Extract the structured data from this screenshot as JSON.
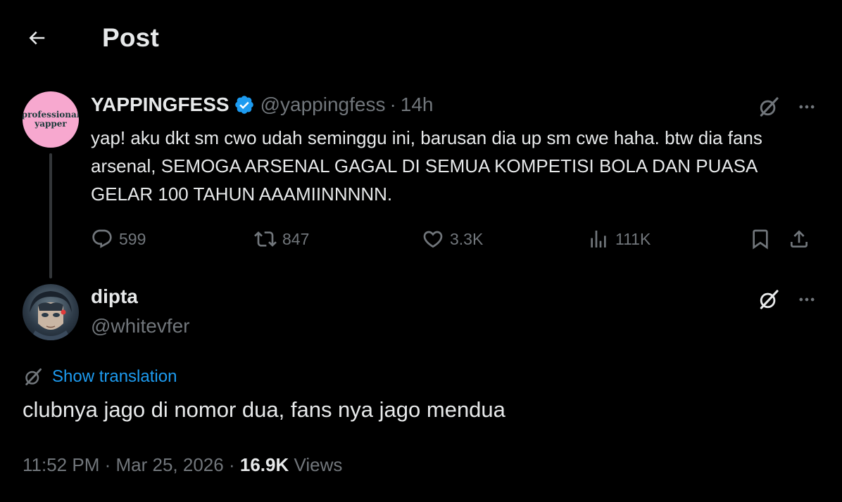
{
  "header": {
    "title": "Post",
    "back_icon": "arrow-left-icon"
  },
  "original_post": {
    "avatar_text_line1": "professional",
    "avatar_text_line2": "yapper",
    "display_name": "YAPPINGFESS",
    "verified": true,
    "handle": "@yappingfess",
    "separator": "·",
    "time": "14h",
    "text": "yap! aku dkt sm cwo udah seminggu ini, barusan dia up sm cwe haha. btw dia fans arsenal, SEMOGA ARSENAL GAGAL DI SEMUA KOMPETISI BOLA DAN PUASA GELAR 100 TAHUN AAAMIINNNNN.",
    "stats": {
      "replies": "599",
      "reposts": "847",
      "likes": "3.3K",
      "views": "111K"
    }
  },
  "reply": {
    "display_name": "dipta",
    "handle": "@whitevfer",
    "translate_label": "Show translation",
    "text": "clubnya jago di nomor dua, fans nya jago mendua",
    "time": "11:52 PM",
    "separator": "·",
    "date": "Mar 25, 2026",
    "views_count": "16.9K",
    "views_label": "Views"
  },
  "colors": {
    "background": "#000000",
    "text_primary": "#e7e9ea",
    "text_secondary": "#71767b",
    "accent": "#1d9bf0",
    "verified_badge": "#1d9bf0",
    "thread_line": "#333639"
  }
}
